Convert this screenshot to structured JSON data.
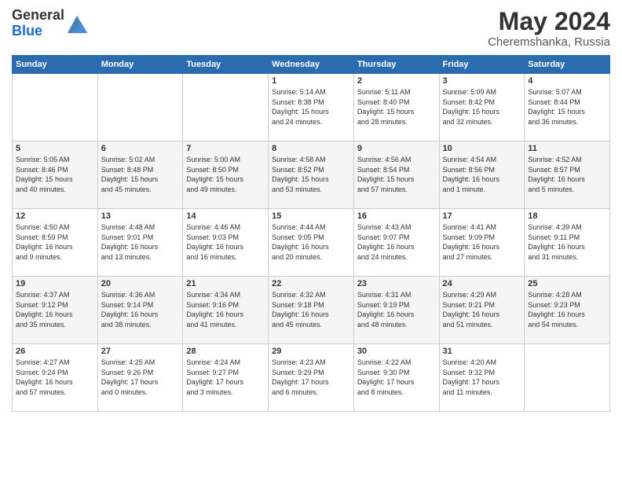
{
  "logo": {
    "general": "General",
    "blue": "Blue"
  },
  "header": {
    "title": "May 2024",
    "subtitle": "Cheremshanka, Russia"
  },
  "weekdays": [
    "Sunday",
    "Monday",
    "Tuesday",
    "Wednesday",
    "Thursday",
    "Friday",
    "Saturday"
  ],
  "weeks": [
    [
      {
        "day": "",
        "info": ""
      },
      {
        "day": "",
        "info": ""
      },
      {
        "day": "",
        "info": ""
      },
      {
        "day": "1",
        "info": "Sunrise: 5:14 AM\nSunset: 8:38 PM\nDaylight: 15 hours\nand 24 minutes."
      },
      {
        "day": "2",
        "info": "Sunrise: 5:11 AM\nSunset: 8:40 PM\nDaylight: 15 hours\nand 28 minutes."
      },
      {
        "day": "3",
        "info": "Sunrise: 5:09 AM\nSunset: 8:42 PM\nDaylight: 15 hours\nand 32 minutes."
      },
      {
        "day": "4",
        "info": "Sunrise: 5:07 AM\nSunset: 8:44 PM\nDaylight: 15 hours\nand 36 minutes."
      }
    ],
    [
      {
        "day": "5",
        "info": "Sunrise: 5:05 AM\nSunset: 8:46 PM\nDaylight: 15 hours\nand 40 minutes."
      },
      {
        "day": "6",
        "info": "Sunrise: 5:02 AM\nSunset: 8:48 PM\nDaylight: 15 hours\nand 45 minutes."
      },
      {
        "day": "7",
        "info": "Sunrise: 5:00 AM\nSunset: 8:50 PM\nDaylight: 15 hours\nand 49 minutes."
      },
      {
        "day": "8",
        "info": "Sunrise: 4:58 AM\nSunset: 8:52 PM\nDaylight: 15 hours\nand 53 minutes."
      },
      {
        "day": "9",
        "info": "Sunrise: 4:56 AM\nSunset: 8:54 PM\nDaylight: 15 hours\nand 57 minutes."
      },
      {
        "day": "10",
        "info": "Sunrise: 4:54 AM\nSunset: 8:56 PM\nDaylight: 16 hours\nand 1 minute."
      },
      {
        "day": "11",
        "info": "Sunrise: 4:52 AM\nSunset: 8:57 PM\nDaylight: 16 hours\nand 5 minutes."
      }
    ],
    [
      {
        "day": "12",
        "info": "Sunrise: 4:50 AM\nSunset: 8:59 PM\nDaylight: 16 hours\nand 9 minutes."
      },
      {
        "day": "13",
        "info": "Sunrise: 4:48 AM\nSunset: 9:01 PM\nDaylight: 16 hours\nand 13 minutes."
      },
      {
        "day": "14",
        "info": "Sunrise: 4:46 AM\nSunset: 9:03 PM\nDaylight: 16 hours\nand 16 minutes."
      },
      {
        "day": "15",
        "info": "Sunrise: 4:44 AM\nSunset: 9:05 PM\nDaylight: 16 hours\nand 20 minutes."
      },
      {
        "day": "16",
        "info": "Sunrise: 4:43 AM\nSunset: 9:07 PM\nDaylight: 16 hours\nand 24 minutes."
      },
      {
        "day": "17",
        "info": "Sunrise: 4:41 AM\nSunset: 9:09 PM\nDaylight: 16 hours\nand 27 minutes."
      },
      {
        "day": "18",
        "info": "Sunrise: 4:39 AM\nSunset: 9:11 PM\nDaylight: 16 hours\nand 31 minutes."
      }
    ],
    [
      {
        "day": "19",
        "info": "Sunrise: 4:37 AM\nSunset: 9:12 PM\nDaylight: 16 hours\nand 35 minutes."
      },
      {
        "day": "20",
        "info": "Sunrise: 4:36 AM\nSunset: 9:14 PM\nDaylight: 16 hours\nand 38 minutes."
      },
      {
        "day": "21",
        "info": "Sunrise: 4:34 AM\nSunset: 9:16 PM\nDaylight: 16 hours\nand 41 minutes."
      },
      {
        "day": "22",
        "info": "Sunrise: 4:32 AM\nSunset: 9:18 PM\nDaylight: 16 hours\nand 45 minutes."
      },
      {
        "day": "23",
        "info": "Sunrise: 4:31 AM\nSunset: 9:19 PM\nDaylight: 16 hours\nand 48 minutes."
      },
      {
        "day": "24",
        "info": "Sunrise: 4:29 AM\nSunset: 9:21 PM\nDaylight: 16 hours\nand 51 minutes."
      },
      {
        "day": "25",
        "info": "Sunrise: 4:28 AM\nSunset: 9:23 PM\nDaylight: 16 hours\nand 54 minutes."
      }
    ],
    [
      {
        "day": "26",
        "info": "Sunrise: 4:27 AM\nSunset: 9:24 PM\nDaylight: 16 hours\nand 57 minutes."
      },
      {
        "day": "27",
        "info": "Sunrise: 4:25 AM\nSunset: 9:26 PM\nDaylight: 17 hours\nand 0 minutes."
      },
      {
        "day": "28",
        "info": "Sunrise: 4:24 AM\nSunset: 9:27 PM\nDaylight: 17 hours\nand 3 minutes."
      },
      {
        "day": "29",
        "info": "Sunrise: 4:23 AM\nSunset: 9:29 PM\nDaylight: 17 hours\nand 6 minutes."
      },
      {
        "day": "30",
        "info": "Sunrise: 4:22 AM\nSunset: 9:30 PM\nDaylight: 17 hours\nand 8 minutes."
      },
      {
        "day": "31",
        "info": "Sunrise: 4:20 AM\nSunset: 9:32 PM\nDaylight: 17 hours\nand 11 minutes."
      },
      {
        "day": "",
        "info": ""
      }
    ]
  ]
}
